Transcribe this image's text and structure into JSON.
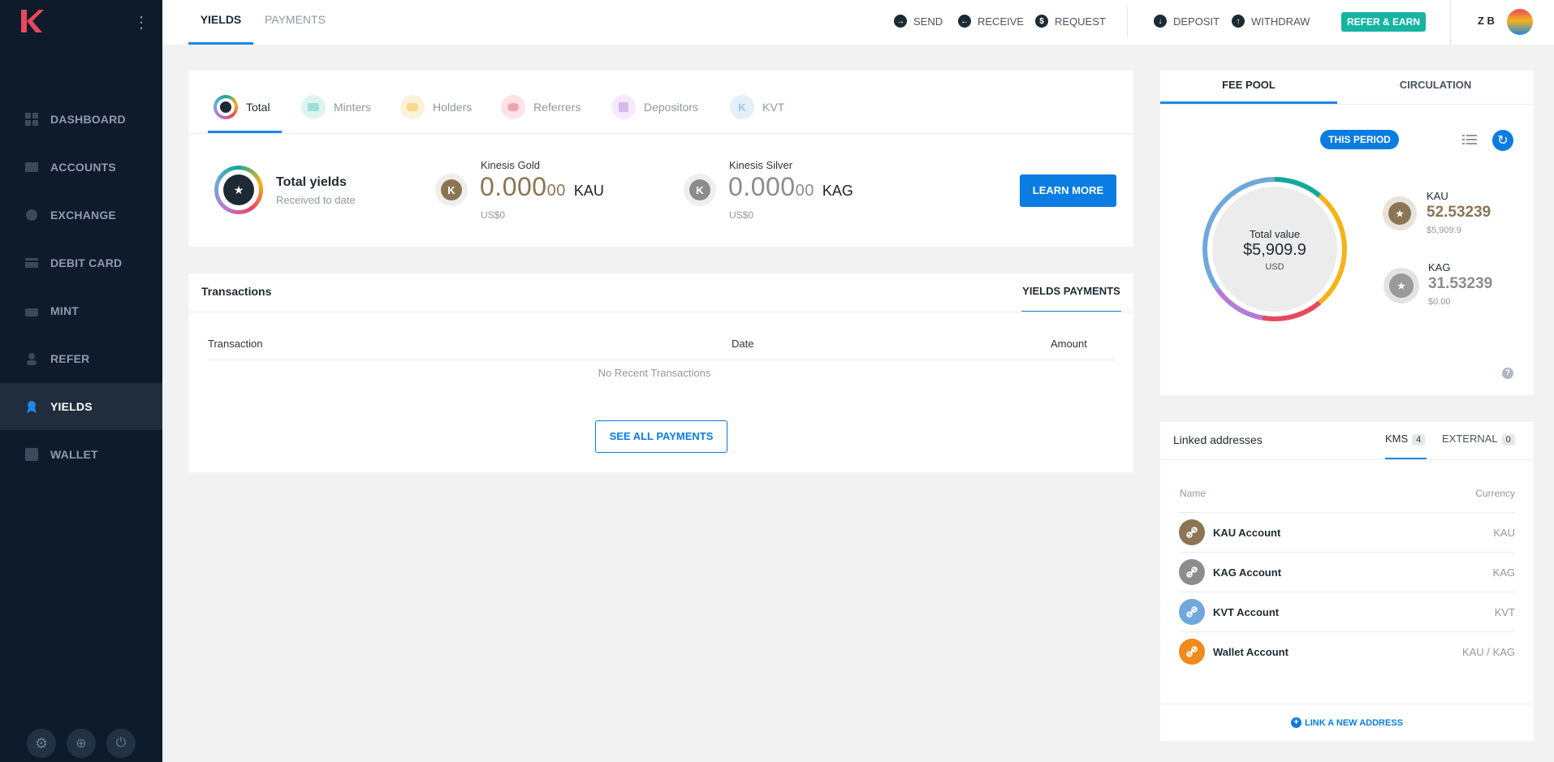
{
  "sidebar": {
    "nav": [
      {
        "label": "DASHBOARD",
        "icon": "dashboard-icon"
      },
      {
        "label": "ACCOUNTS",
        "icon": "wallet-card-icon"
      },
      {
        "label": "EXCHANGE",
        "icon": "globe-icon"
      },
      {
        "label": "DEBIT CARD",
        "icon": "credit-card-icon"
      },
      {
        "label": "MINT",
        "icon": "mint-icon"
      },
      {
        "label": "REFER",
        "icon": "person-icon"
      },
      {
        "label": "YIELDS",
        "icon": "award-icon"
      },
      {
        "label": "WALLET",
        "icon": "wallet-icon"
      }
    ],
    "active": "YIELDS"
  },
  "topbar": {
    "tabs": [
      "YIELDS",
      "PAYMENTS"
    ],
    "actions": {
      "send": "SEND",
      "receive": "RECEIVE",
      "request": "REQUEST",
      "deposit": "DEPOSIT",
      "withdraw": "WITHDRAW"
    },
    "refer": "REFER & EARN",
    "user_initials": "Z B"
  },
  "yields": {
    "tabs": [
      "Total",
      "Minters",
      "Holders",
      "Referrers",
      "Depositors",
      "KVT"
    ],
    "total_title": "Total yields",
    "total_sub": "Received to date",
    "gold": {
      "label": "Kinesis Gold",
      "amount_main": "0.000",
      "amount_small": "00",
      "unit": "KAU",
      "usd": "US$0"
    },
    "silver": {
      "label": "Kinesis Silver",
      "amount_main": "0.000",
      "amount_small": "00",
      "unit": "KAG",
      "usd": "US$0"
    },
    "learn_more": "LEARN MORE"
  },
  "transactions": {
    "title": "Transactions",
    "tab": "YIELDS PAYMENTS",
    "columns": [
      "Transaction",
      "Date",
      "Amount"
    ],
    "empty": "No Recent Transactions",
    "see_all": "SEE ALL PAYMENTS"
  },
  "feepool": {
    "tabs": [
      "FEE POOL",
      "CIRCULATION"
    ],
    "period": "THIS PERIOD",
    "total_label": "Total value",
    "total_value": "$5,909.9",
    "total_unit": "USD",
    "kau": {
      "label": "KAU",
      "value": "52.53239",
      "usd": "$5,909.9"
    },
    "kag": {
      "label": "KAG",
      "value": "31.53239",
      "usd": "$0.00"
    },
    "ring_colors": [
      "#14a89b",
      "#f5b31a",
      "#e8485e",
      "#b57ad6",
      "#6fa8dc"
    ]
  },
  "linked": {
    "title": "Linked addresses",
    "kms_label": "KMS",
    "kms_count": "4",
    "external_label": "EXTERNAL",
    "external_count": "0",
    "columns": [
      "Name",
      "Currency"
    ],
    "rows": [
      {
        "name": "KAU Account",
        "currency": "KAU",
        "color": "#8b7553"
      },
      {
        "name": "KAG Account",
        "currency": "KAG",
        "color": "#8c8c8c"
      },
      {
        "name": "KVT Account",
        "currency": "KVT",
        "color": "#6fa8dc"
      },
      {
        "name": "Wallet Account",
        "currency": "KAU / KAG",
        "color": "#f08a1d"
      }
    ],
    "link_new": "LINK A NEW ADDRESS"
  }
}
